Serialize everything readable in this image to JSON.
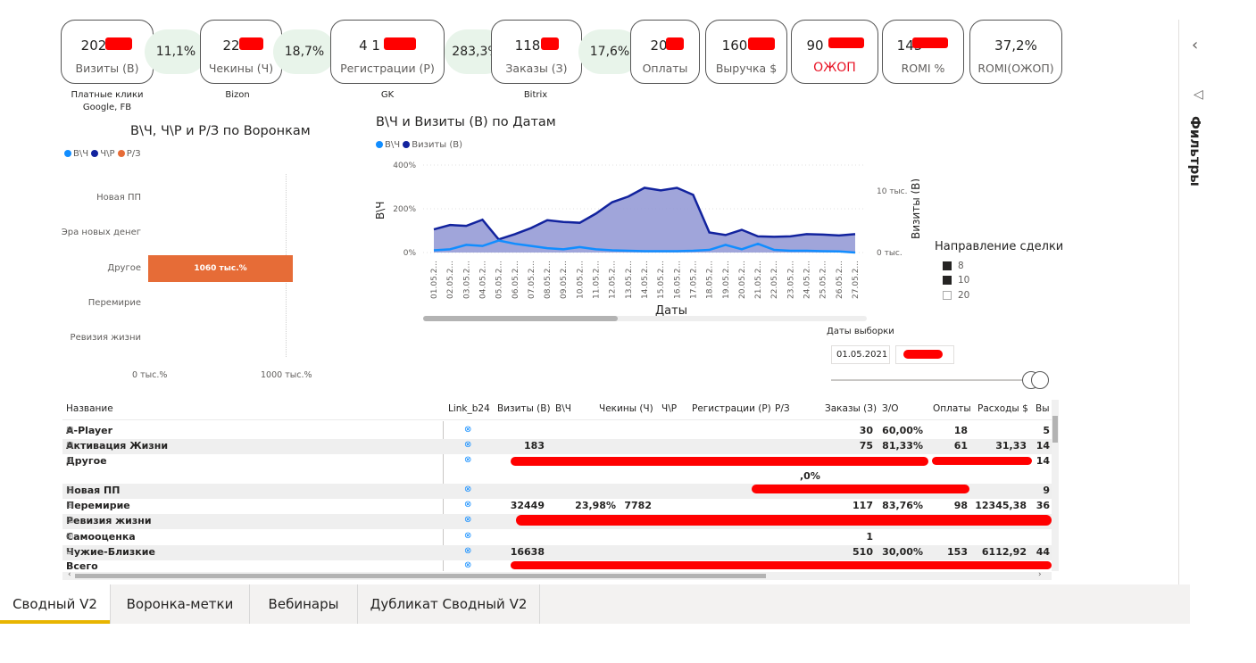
{
  "kpis": [
    {
      "value": "202",
      "label": "Визиты (В)"
    },
    {
      "value": "22",
      "label": "Чекины (Ч)"
    },
    {
      "value": "4 1",
      "label": "Регистрации (Р)"
    },
    {
      "value": "118",
      "label": "Заказы (З)"
    },
    {
      "value": "20",
      "label": "Оплаты"
    },
    {
      "value": "160",
      "label": "Выручка $"
    },
    {
      "value": "90",
      "label": "ОЖОП"
    },
    {
      "value": "143",
      "label": "ROMI %"
    },
    {
      "value": "37,2%",
      "label": "ROMI(ОЖОП)"
    }
  ],
  "ratios": [
    "11,1%",
    "18,7%",
    "283,3%",
    "17,6%"
  ],
  "sources": [
    "Платные клики\nGoogle, FB",
    "Bizon",
    "GK",
    "Bitrix"
  ],
  "funnel_chart": {
    "title": "В\\Ч, Ч\\Р и Р/З по Воронкам",
    "legend": [
      "В\\Ч",
      "Ч\\Р",
      "Р/З"
    ],
    "colors": [
      "#118dff",
      "#12239e",
      "#e66c37"
    ],
    "categories": [
      "Новая ПП",
      "Эра новых денег",
      "Другое",
      "Перемирие",
      "Ревизия жизни"
    ],
    "bar_label": "1060 тыс.%",
    "x_ticks": [
      "0 тыс.%",
      "1000 тыс.%"
    ]
  },
  "chart_data": {
    "type": "area",
    "title": "В\\Ч и Визиты (В) по Датам",
    "xlabel": "Даты",
    "ylabel": "В\\Ч",
    "y2label": "Визиты (В)",
    "y_ticks": [
      "400%",
      "200%",
      "0%"
    ],
    "y2_ticks": [
      "10 тыс.",
      "0 тыс."
    ],
    "x": [
      "01.05.2...",
      "02.05.2...",
      "03.05.2...",
      "04.05.2...",
      "05.05.2...",
      "06.05.2...",
      "07.05.2...",
      "08.05.2...",
      "09.05.2...",
      "10.05.2...",
      "11.05.2...",
      "12.05.2...",
      "13.05.2...",
      "14.05.2...",
      "15.05.2...",
      "16.05.2...",
      "17.05.2...",
      "18.05.2...",
      "19.05.2...",
      "20.05.2...",
      "21.05.2...",
      "22.05.2...",
      "23.05.2...",
      "24.05.2...",
      "25.05.2...",
      "26.05.2...",
      "27.05.2..."
    ],
    "series": [
      {
        "name": "Визиты (В)",
        "color": "#12239e",
        "values": [
          5300,
          6300,
          6100,
          7500,
          3000,
          4200,
          5600,
          7400,
          7000,
          6800,
          8900,
          11500,
          12800,
          14800,
          14200,
          14800,
          13200,
          4600,
          4000,
          5200,
          3700,
          3600,
          3700,
          4200,
          4100,
          3900,
          4200
        ]
      },
      {
        "name": "В\\Ч",
        "color": "#118dff",
        "values": [
          10,
          15,
          35,
          30,
          55,
          40,
          30,
          20,
          15,
          25,
          15,
          10,
          8,
          6,
          6,
          6,
          8,
          12,
          35,
          15,
          40,
          12,
          8,
          8,
          6,
          5,
          0
        ]
      }
    ],
    "ylim": [
      0,
      400
    ],
    "y2lim": [
      0,
      20000
    ]
  },
  "direction_legend": {
    "title": "Направление сделки",
    "items": [
      "8",
      "10",
      "20"
    ],
    "colors": [
      "#252423",
      "#252423",
      "#ffffff"
    ]
  },
  "date_filter": {
    "title": "Даты выборки",
    "from": "01.05.2021"
  },
  "filters_label": "Фильтры",
  "table": {
    "columns": [
      "Название",
      "Link_b24",
      "Визиты (В)",
      "В\\Ч",
      "Чекины (Ч)",
      "Ч\\Р",
      "Регистрации (Р)",
      "Р/З",
      "Заказы (З)",
      "З/О",
      "Оплаты",
      "Расходы $",
      "Вы"
    ],
    "rows": [
      {
        "name": "A-Player",
        "visits": "",
        "vch": "",
        "checkins": "",
        "orders": "30",
        "zo": "60,00%",
        "pays": "18",
        "costs": "",
        "rev": "5"
      },
      {
        "name": "Активация Жизни",
        "visits": "183",
        "vch": "",
        "checkins": "",
        "orders": "75",
        "zo": "81,33%",
        "pays": "61",
        "costs": "31,33",
        "rev": "14"
      },
      {
        "name": "Другое",
        "visits": "",
        "vch": "",
        "checkins": "",
        "orders": "",
        "zo": "",
        "pays": "",
        "costs": "",
        "rev": "14"
      },
      {
        "name": "Новая ПП",
        "visits": "",
        "vch": "",
        "checkins": "",
        "orders": "",
        "zo": "",
        "pays": "",
        "costs": "",
        "rev": "9"
      },
      {
        "name": "Перемирие",
        "visits": "32449",
        "vch": "23,98%",
        "checkins": "7782",
        "orders": "117",
        "zo": "83,76%",
        "pays": "98",
        "costs": "12345,38",
        "rev": "36"
      },
      {
        "name": "Ревизия жизни",
        "visits": "",
        "vch": "",
        "checkins": "",
        "orders": "",
        "zo": "",
        "pays": "",
        "costs": "",
        "rev": ""
      },
      {
        "name": "Самооценка",
        "visits": "",
        "vch": "",
        "checkins": "",
        "orders": "1",
        "zo": "",
        "pays": "",
        "costs": "",
        "rev": ""
      },
      {
        "name": "Чужие-Близкие",
        "visits": "16638",
        "vch": "",
        "checkins": "",
        "orders": "510",
        "zo": "30,00%",
        "pays": "153",
        "costs": "6112,92",
        "rev": "44"
      },
      {
        "name": "Всего",
        "visits": "",
        "vch": "",
        "checkins": "",
        "orders": "",
        "zo": "",
        "pays": "",
        "costs": "",
        "rev": ""
      }
    ],
    "extra_value": ",0%"
  },
  "tabs": [
    "Сводный V2",
    "Воронка-метки",
    "Вебинары",
    "Дубликат Сводный V2"
  ],
  "active_tab": 0
}
